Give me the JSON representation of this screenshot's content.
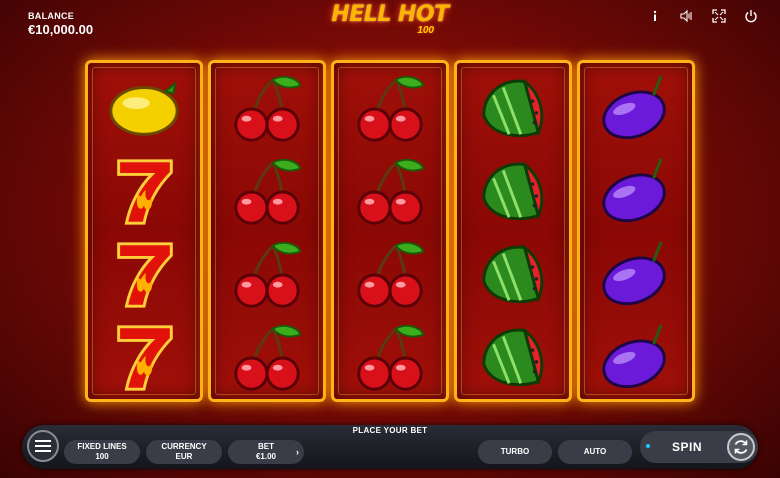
{
  "header": {
    "balance_label": "BALANCE",
    "balance_value": "€10,000.00",
    "logo_main": "HELL HOT",
    "logo_sub": "100",
    "icons": [
      "info-icon",
      "sound-icon",
      "fullscreen-icon",
      "power-icon"
    ]
  },
  "reels": [
    [
      "lemon",
      "seven",
      "seven",
      "seven"
    ],
    [
      "cherry",
      "cherry",
      "cherry",
      "cherry"
    ],
    [
      "cherry",
      "cherry",
      "cherry",
      "cherry"
    ],
    [
      "watermelon",
      "watermelon",
      "watermelon",
      "watermelon"
    ],
    [
      "plum",
      "plum",
      "plum",
      "plum"
    ]
  ],
  "controls": {
    "place_bet": "PLACE YOUR BET",
    "fixed_lines_label": "FIXED LINES",
    "fixed_lines_value": "100",
    "currency_label": "CURRENCY",
    "currency_value": "EUR",
    "bet_label": "BET",
    "bet_value": "€1.00",
    "bet_arrow": "›",
    "turbo_label": "TURBO",
    "auto_label": "AUTO",
    "spin_label": "SPIN"
  },
  "colors": {
    "frame": "#ffb21a",
    "background": "#8a0805",
    "spin_accent": "#1fc6ff"
  }
}
